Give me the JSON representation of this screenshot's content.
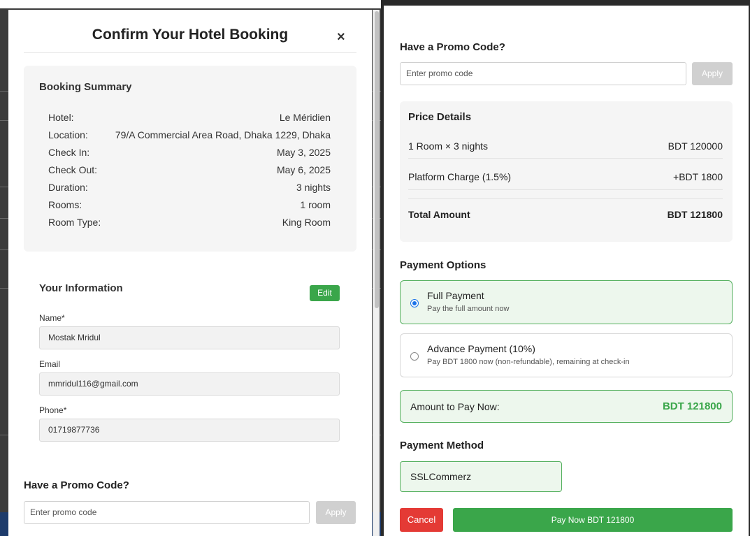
{
  "left": {
    "modal_title": "Confirm Your Hotel Booking",
    "close_glyph": "×",
    "summary": {
      "title": "Booking Summary",
      "rows": [
        {
          "label": "Hotel:",
          "value": "Le Méridien"
        },
        {
          "label": "Location:",
          "value": "79/A Commercial Area Road, Dhaka 1229, Dhaka"
        },
        {
          "label": "Check In:",
          "value": "May 3, 2025"
        },
        {
          "label": "Check Out:",
          "value": "May 6, 2025"
        },
        {
          "label": "Duration:",
          "value": "3 nights"
        },
        {
          "label": "Rooms:",
          "value": "1 room"
        },
        {
          "label": "Room Type:",
          "value": "King Room"
        }
      ]
    },
    "info": {
      "title": "Your Information",
      "edit_label": "Edit",
      "name_label": "Name*",
      "name_value": "Mostak Mridul",
      "email_label": "Email",
      "email_value": "mmridul116@gmail.com",
      "phone_label": "Phone*",
      "phone_value": "01719877736"
    },
    "promo": {
      "title": "Have a Promo Code?",
      "placeholder": "Enter promo code",
      "apply_label": "Apply"
    }
  },
  "right": {
    "promo": {
      "title": "Have a Promo Code?",
      "placeholder": "Enter promo code",
      "apply_label": "Apply"
    },
    "price": {
      "title": "Price Details",
      "rows": [
        {
          "label": "1 Room × 3 nights",
          "value": "BDT 120000"
        },
        {
          "label": "Platform Charge (1.5%)",
          "value": "+BDT 1800"
        }
      ],
      "total_label": "Total Amount",
      "total_value": "BDT 121800"
    },
    "payment_options": {
      "title": "Payment Options",
      "options": [
        {
          "label": "Full Payment",
          "sub": "Pay the full amount now",
          "selected": true
        },
        {
          "label": "Advance Payment (10%)",
          "sub": "Pay BDT 1800 now (non-refundable), remaining at check-in",
          "selected": false
        }
      ]
    },
    "amount_now": {
      "label": "Amount to Pay Now:",
      "value": "BDT 121800"
    },
    "method": {
      "title": "Payment Method",
      "value": "SSLCommerz"
    },
    "actions": {
      "cancel_label": "Cancel",
      "pay_label": "Pay Now BDT 121800"
    }
  },
  "colors": {
    "accent_green": "#3aa64a",
    "danger_red": "#e43a35",
    "radio_blue": "#1a73e8"
  }
}
